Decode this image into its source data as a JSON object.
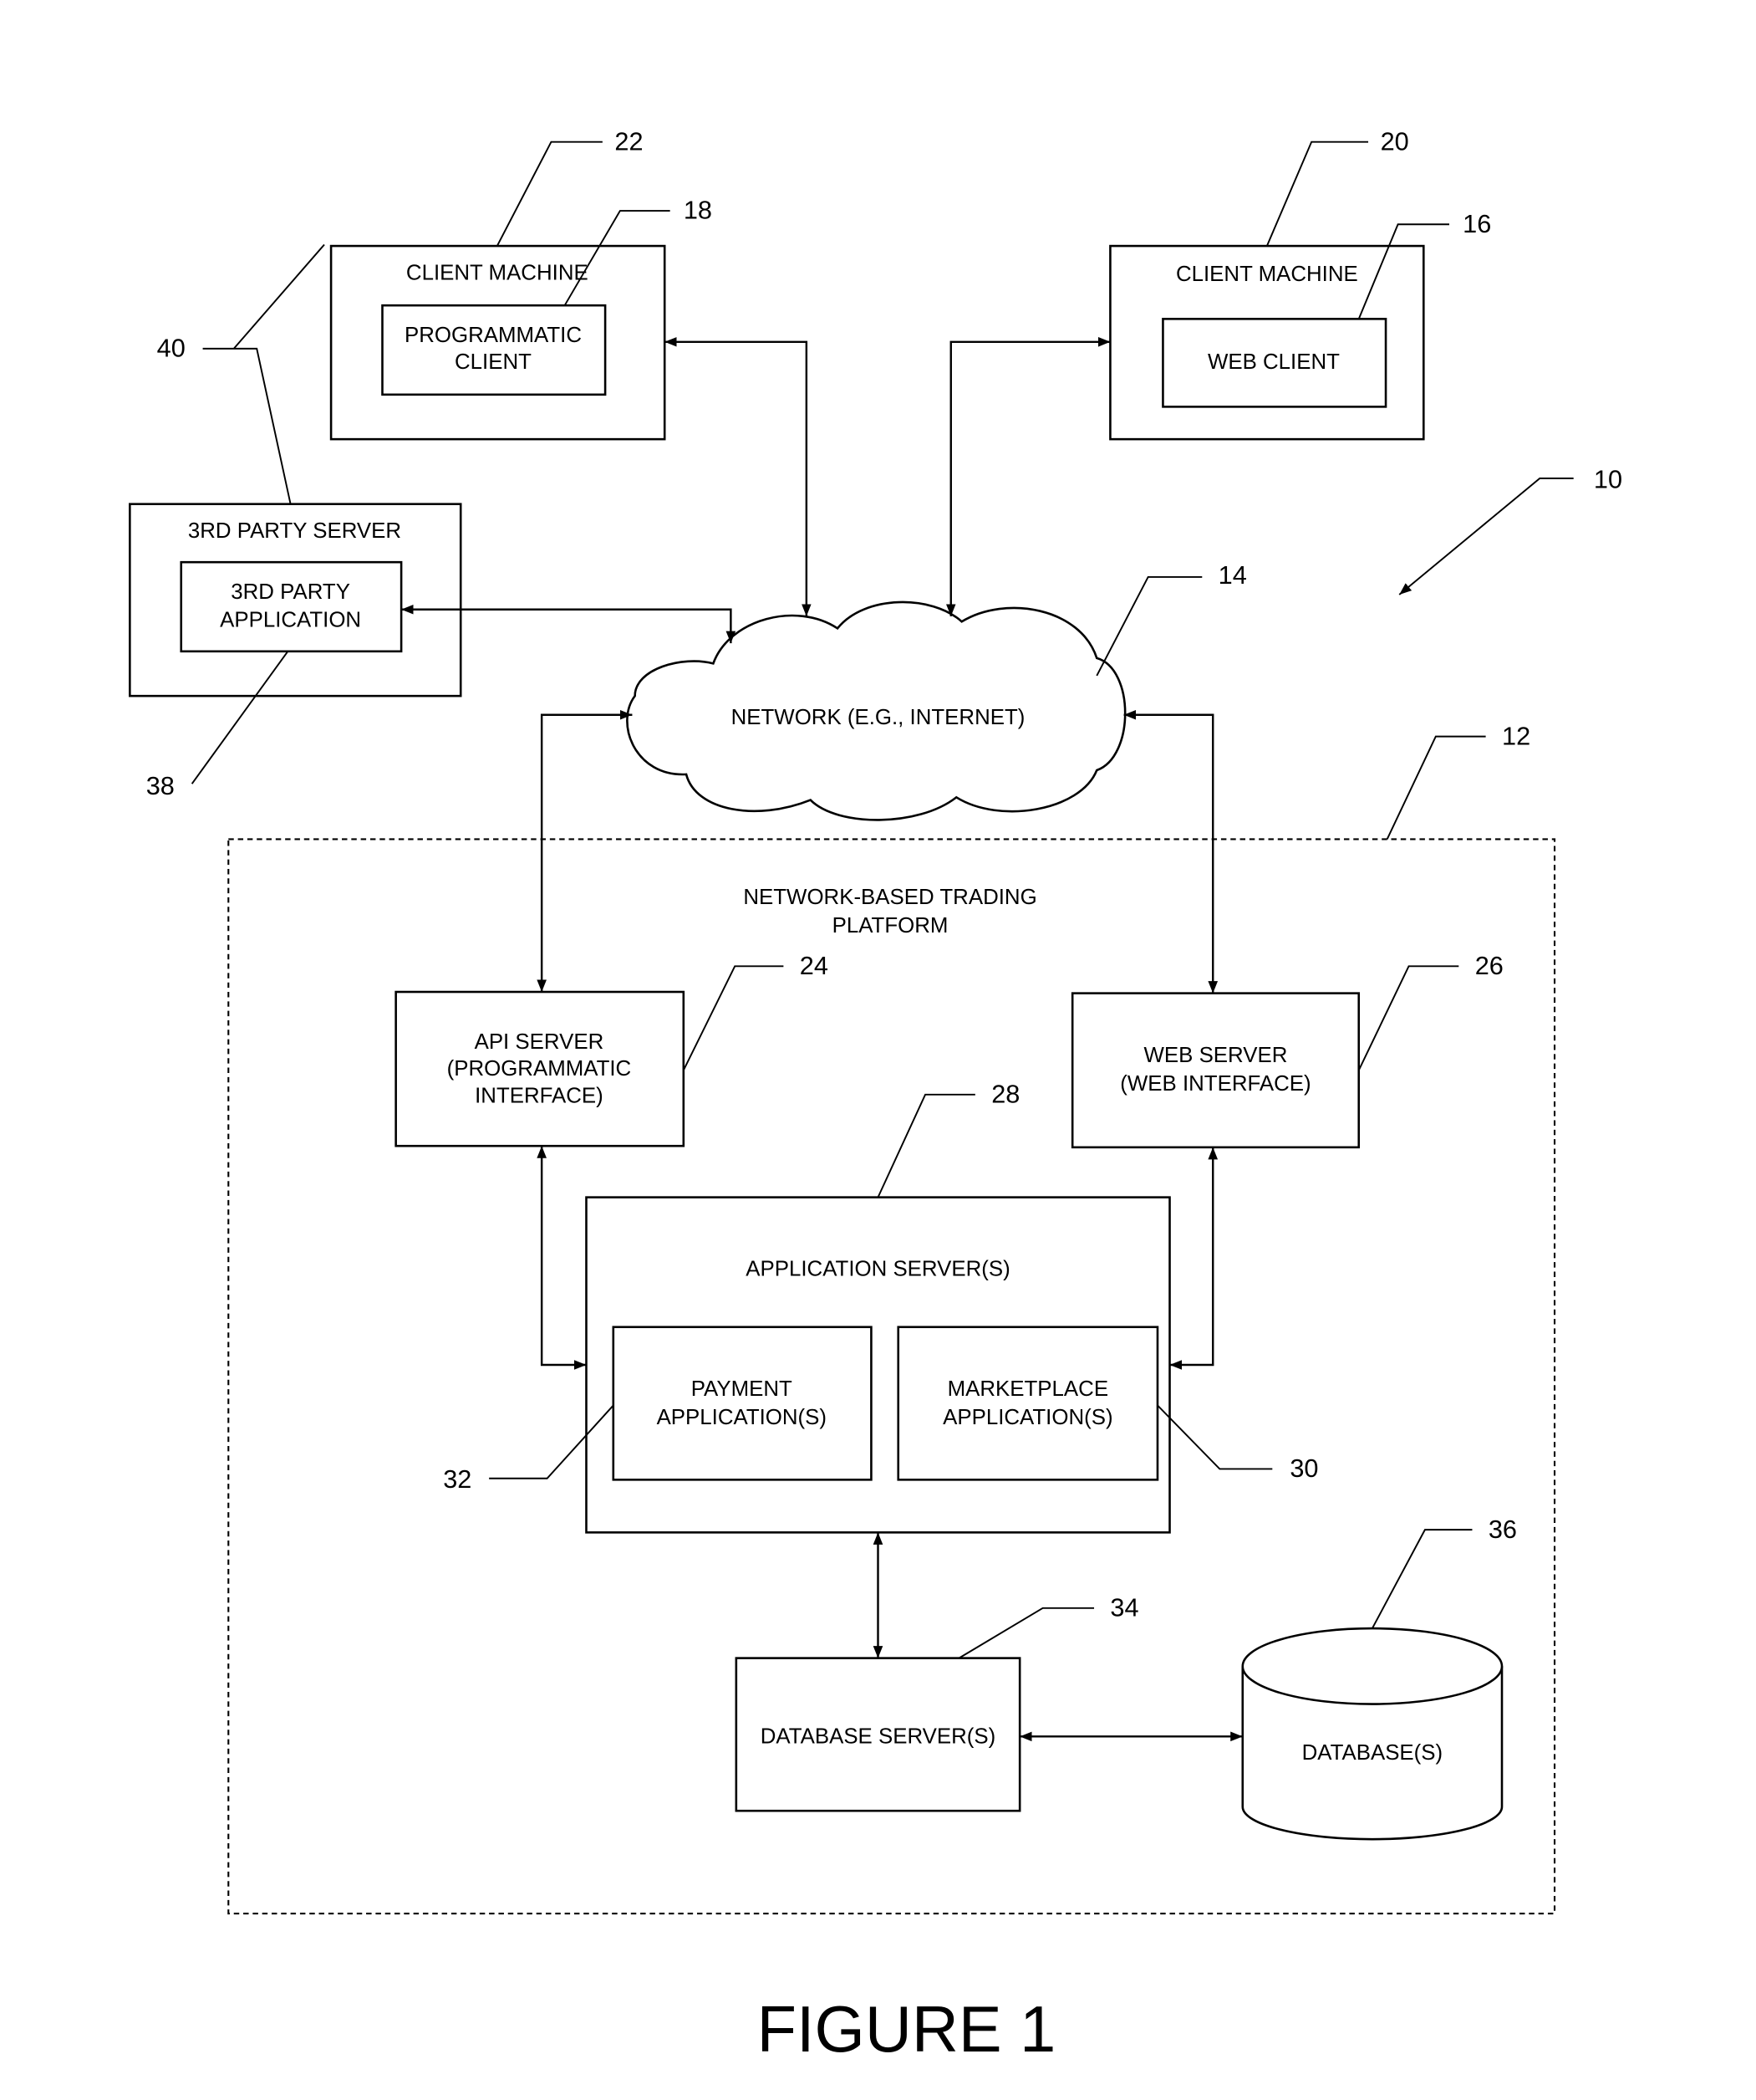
{
  "figure": {
    "title": "FIGURE 1"
  },
  "nodes": {
    "client_machine_left": {
      "title": "CLIENT MACHINE",
      "ref": "22"
    },
    "programmatic_client": {
      "lines": [
        "PROGRAMMATIC",
        "CLIENT"
      ],
      "ref": "18"
    },
    "client_machine_right": {
      "title": "CLIENT MACHINE",
      "ref": "20"
    },
    "web_client": {
      "lines": [
        "WEB CLIENT"
      ],
      "ref": "16"
    },
    "third_party_server": {
      "title": "3RD PARTY SERVER",
      "ref": "40"
    },
    "third_party_application": {
      "lines": [
        "3RD PARTY",
        "APPLICATION"
      ],
      "ref": "38"
    },
    "network": {
      "label": "NETWORK (E.G., INTERNET)",
      "ref": "14"
    },
    "system": {
      "ref": "10"
    },
    "trading_platform": {
      "lines": [
        "NETWORK-BASED TRADING",
        "PLATFORM"
      ],
      "ref": "12"
    },
    "api_server": {
      "lines": [
        "API SERVER",
        "(PROGRAMMATIC",
        "INTERFACE)"
      ],
      "ref": "24"
    },
    "web_server": {
      "lines": [
        "WEB SERVER",
        "(WEB INTERFACE)"
      ],
      "ref": "26"
    },
    "application_servers": {
      "title": "APPLICATION SERVER(S)",
      "ref": "28"
    },
    "payment_applications": {
      "lines": [
        "PAYMENT",
        "APPLICATION(S)"
      ],
      "ref": "32"
    },
    "marketplace_applications": {
      "lines": [
        "MARKETPLACE",
        "APPLICATION(S)"
      ],
      "ref": "30"
    },
    "database_servers": {
      "lines": [
        "DATABASE SERVER(S)"
      ],
      "ref": "34"
    },
    "databases": {
      "lines": [
        "DATABASE(S)"
      ],
      "ref": "36"
    }
  }
}
